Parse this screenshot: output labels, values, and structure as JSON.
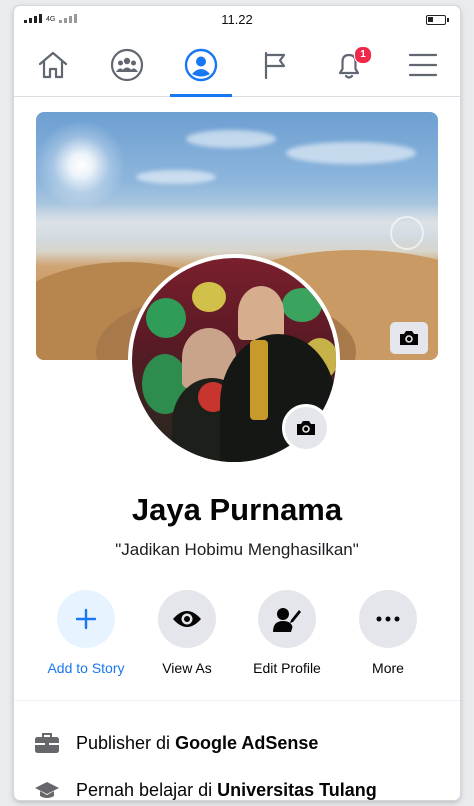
{
  "status_bar": {
    "time": "11.22",
    "network": "4G"
  },
  "nav": {
    "items": [
      {
        "name": "home",
        "icon": "home-icon"
      },
      {
        "name": "groups",
        "icon": "groups-icon"
      },
      {
        "name": "profile",
        "icon": "profile-icon",
        "active": true
      },
      {
        "name": "pages",
        "icon": "flag-icon"
      },
      {
        "name": "notifications",
        "icon": "bell-icon",
        "badge": "1"
      },
      {
        "name": "menu",
        "icon": "hamburger-icon"
      }
    ],
    "accent": "#1877f2",
    "badge_color": "#f02849"
  },
  "profile": {
    "name": "Jaya Purnama",
    "bio": "\"Jadikan Hobimu Menghasilkan\""
  },
  "actions": [
    {
      "label": "Add to Story",
      "icon": "plus-icon"
    },
    {
      "label": "View As",
      "icon": "eye-icon"
    },
    {
      "label": "Edit Profile",
      "icon": "edit-profile-icon"
    },
    {
      "label": "More",
      "icon": "more-icon"
    }
  ],
  "intro": {
    "work_prefix": "Publisher di ",
    "work_place": "Google AdSense",
    "edu_prefix": "Pernah belajar di ",
    "edu_place": "Universitas Tulang"
  }
}
